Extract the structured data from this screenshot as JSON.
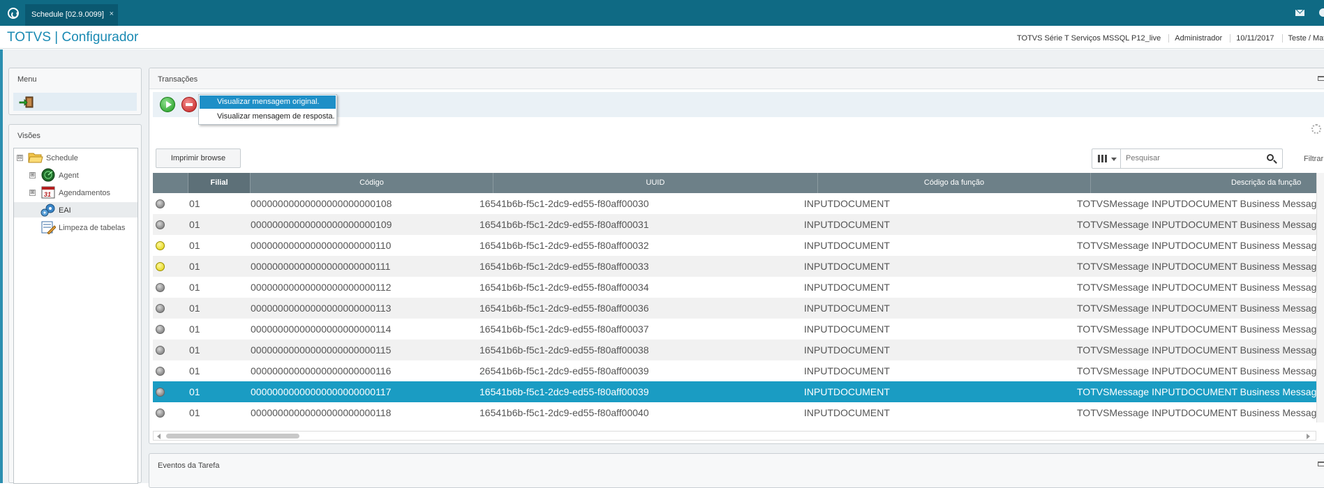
{
  "tab": {
    "title": "Schedule [02.9.0099]",
    "close": "×"
  },
  "header": {
    "app_title": "TOTVS | Configurador",
    "environment": "TOTVS Série T Serviços MSSQL P12_live",
    "user": "Administrador",
    "date": "10/11/2017",
    "company": "Teste / Mat"
  },
  "menu": {
    "title": "Menu",
    "icon": "exit-icon"
  },
  "visoes": {
    "title": "Visões",
    "tree": [
      {
        "label": "Schedule",
        "icon": "folder-icon",
        "expander": "⊟"
      },
      {
        "label": "Agent",
        "icon": "agent-icon",
        "expander": "⊞"
      },
      {
        "label": "Agendamentos",
        "icon": "calendar-icon",
        "expander": "⊞",
        "badge": "31"
      },
      {
        "label": "EAI",
        "icon": "gears-icon"
      },
      {
        "label": "Limpeza de tabelas",
        "icon": "cleanup-icon"
      }
    ]
  },
  "transacoes": {
    "title": "Transações"
  },
  "context_menu": {
    "items": [
      "Visualizar mensagem original.",
      "Visualizar mensagem de resposta."
    ]
  },
  "browse": {
    "print_label": "Imprimir browse",
    "search_placeholder": "Pesquisar",
    "filter_label": "Filtrar"
  },
  "grid": {
    "columns": [
      "",
      "Filial",
      "Código",
      "UUID",
      "Código da função",
      "Descrição da função"
    ],
    "rows": [
      {
        "status": "gray",
        "filial": "01",
        "codigo": "00000000000000000000000108",
        "uuid": "16541b6b-f5c1-2dc9-ed55-f80aff00030",
        "funcao": "INPUTDOCUMENT",
        "descricao": "TOTVSMessage INPUTDOCUMENT Business Message"
      },
      {
        "status": "gray",
        "filial": "01",
        "codigo": "00000000000000000000000109",
        "uuid": "16541b6b-f5c1-2dc9-ed55-f80aff00031",
        "funcao": "INPUTDOCUMENT",
        "descricao": "TOTVSMessage INPUTDOCUMENT Business Message"
      },
      {
        "status": "yellow",
        "filial": "01",
        "codigo": "00000000000000000000000110",
        "uuid": "16541b6b-f5c1-2dc9-ed55-f80aff00032",
        "funcao": "INPUTDOCUMENT",
        "descricao": "TOTVSMessage INPUTDOCUMENT Business Message"
      },
      {
        "status": "yellow",
        "filial": "01",
        "codigo": "00000000000000000000000111",
        "uuid": "16541b6b-f5c1-2dc9-ed55-f80aff00033",
        "funcao": "INPUTDOCUMENT",
        "descricao": "TOTVSMessage INPUTDOCUMENT Business Message"
      },
      {
        "status": "gray",
        "filial": "01",
        "codigo": "00000000000000000000000112",
        "uuid": "16541b6b-f5c1-2dc9-ed55-f80aff00034",
        "funcao": "INPUTDOCUMENT",
        "descricao": "TOTVSMessage INPUTDOCUMENT Business Message"
      },
      {
        "status": "gray",
        "filial": "01",
        "codigo": "00000000000000000000000113",
        "uuid": "16541b6b-f5c1-2dc9-ed55-f80aff00036",
        "funcao": "INPUTDOCUMENT",
        "descricao": "TOTVSMessage INPUTDOCUMENT Business Message"
      },
      {
        "status": "gray",
        "filial": "01",
        "codigo": "00000000000000000000000114",
        "uuid": "16541b6b-f5c1-2dc9-ed55-f80aff00037",
        "funcao": "INPUTDOCUMENT",
        "descricao": "TOTVSMessage INPUTDOCUMENT Business Message"
      },
      {
        "status": "gray",
        "filial": "01",
        "codigo": "00000000000000000000000115",
        "uuid": "16541b6b-f5c1-2dc9-ed55-f80aff00038",
        "funcao": "INPUTDOCUMENT",
        "descricao": "TOTVSMessage INPUTDOCUMENT Business Message"
      },
      {
        "status": "gray",
        "filial": "01",
        "codigo": "00000000000000000000000116",
        "uuid": "26541b6b-f5c1-2dc9-ed55-f80aff00039",
        "funcao": "INPUTDOCUMENT",
        "descricao": "TOTVSMessage INPUTDOCUMENT Business Message"
      },
      {
        "status": "gray",
        "filial": "01",
        "codigo": "00000000000000000000000117",
        "uuid": "16541b6b-f5c1-2dc9-ed55-f80aff00039",
        "funcao": "INPUTDOCUMENT",
        "descricao": "TOTVSMessage INPUTDOCUMENT Business Message",
        "selected": true
      },
      {
        "status": "gray",
        "filial": "01",
        "codigo": "00000000000000000000000118",
        "uuid": "16541b6b-f5c1-2dc9-ed55-f80aff00040",
        "funcao": "INPUTDOCUMENT",
        "descricao": "TOTVSMessage INPUTDOCUMENT Business Message"
      }
    ]
  },
  "eventos": {
    "title": "Eventos da Tarefa"
  },
  "colors": {
    "topbar": "#0f6a84",
    "accent": "#1a8ab3",
    "selected_row": "#1a9cc3",
    "grid_header": "#6d8088",
    "menu_highlight": "#1e8fc7"
  }
}
